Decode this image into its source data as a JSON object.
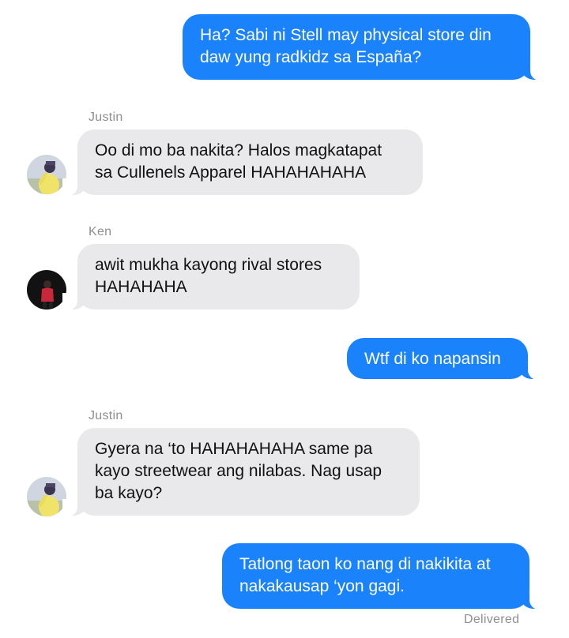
{
  "messages": [
    {
      "direction": "outgoing",
      "text": "Ha? Sabi ni Stell may physical store din\ndaw yung radkidz sa España?"
    },
    {
      "direction": "incoming",
      "sender": "Justin",
      "text": "Oo di mo ba nakita? Halos magkatapat\nsa Cullenels Apparel HAHAHAHAHA"
    },
    {
      "direction": "incoming",
      "sender": "Ken",
      "text": "awit mukha kayong rival stores\nHAHAHAHA"
    },
    {
      "direction": "outgoing",
      "text": "Wtf di ko napansin"
    },
    {
      "direction": "incoming",
      "sender": "Justin",
      "text": "Gyera na ‘to HAHAHAHAHA same pa\nkayo streetwear ang nilabas. Nag usap\nba kayo?"
    },
    {
      "direction": "outgoing",
      "text": "Tatlong taon ko nang di nakikita at\nnakakausap ‘yon gagi."
    }
  ],
  "status": "Delivered",
  "colors": {
    "outgoing_bubble": "#1a82fb",
    "incoming_bubble": "#e9e9eb",
    "meta_text": "#8e8e93"
  },
  "avatars": {
    "justin": "justin-avatar",
    "ken": "ken-avatar"
  }
}
